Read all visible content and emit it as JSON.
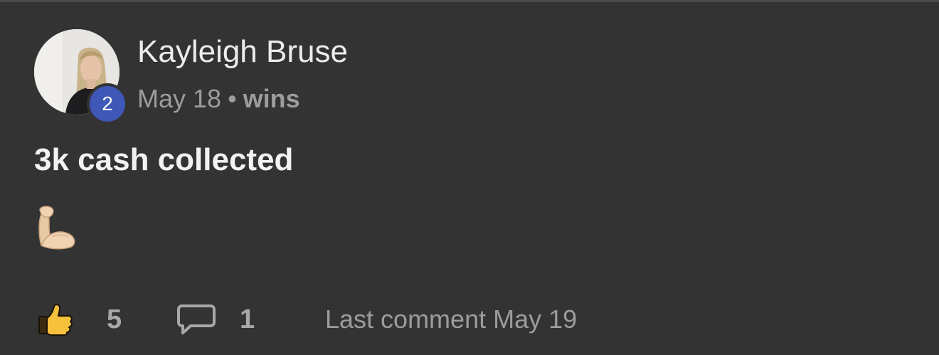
{
  "post": {
    "author": {
      "name": "Kayleigh Bruse",
      "level": "2",
      "level_badge_color": "#3f58b8"
    },
    "date": "May 18",
    "separator": "•",
    "category": "wins",
    "title": "3k cash collected",
    "body_emoji": "flexed-biceps-icon",
    "actions": {
      "like_icon": "thumbs-up-icon",
      "like_count": "5",
      "comment_icon": "comment-bubble-icon",
      "comment_count": "1",
      "last_comment": "Last comment May 19"
    }
  },
  "colors": {
    "background": "#333333",
    "primary_text": "#ececec",
    "secondary_text": "#9c9c9c"
  }
}
